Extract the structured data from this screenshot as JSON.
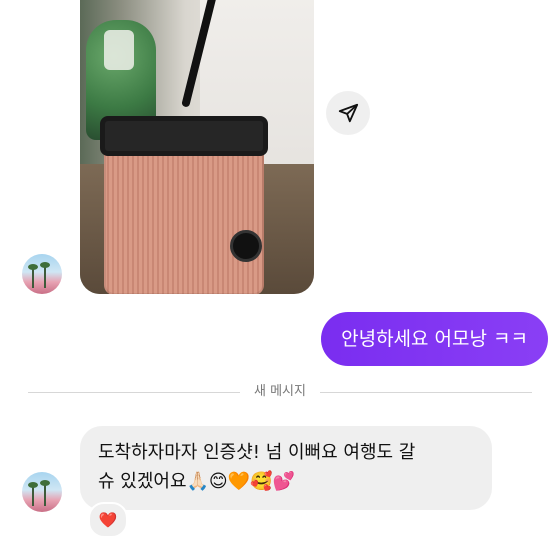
{
  "thread": {
    "photo_message": {
      "type": "image"
    },
    "share_button": {
      "icon": "send-icon"
    },
    "outgoing_message": {
      "text": "안녕하세요 어모낭 ㅋㅋ",
      "bubble_color": "#7b2ff7"
    },
    "divider": {
      "label": "새 메시지"
    },
    "incoming_message": {
      "line1": "도착하자마자 인증샷! 넘 이뻐요 여행도 갈",
      "line2": "슈 있겠어요🙏🏻😊🧡🥰💕",
      "reaction": "❤️"
    }
  }
}
